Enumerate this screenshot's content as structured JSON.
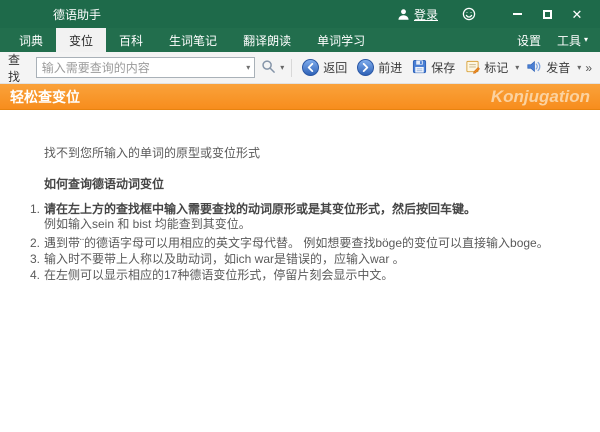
{
  "window": {
    "app_title": "德语助手",
    "login_label": "登录"
  },
  "menubar": {
    "tabs": [
      "词典",
      "变位",
      "百科",
      "生词笔记",
      "翻译朗读",
      "单词学习"
    ],
    "active_tab": "变位",
    "settings_label": "设置",
    "tools_label": "工具"
  },
  "toolbar": {
    "find_label": "查找",
    "search_placeholder": "输入需要查询的内容",
    "search_value": "",
    "back_label": "返回",
    "forward_label": "前进",
    "save_label": "保存",
    "mark_label": "标记",
    "speak_label": "发音",
    "overflow_label": "»"
  },
  "banner": {
    "title": "轻松查变位",
    "subtitle": "Konjugation"
  },
  "content": {
    "message": "找不到您所输入的单词的原型或变位形式",
    "howto_heading": "如何查询德语动词变位",
    "steps": [
      {
        "num": "1.",
        "line1": "请在左上方的查找框中输入需要查找的动词原形或是其变位形式，然后按回车键。",
        "line2": "例如输入sein 和 bist 均能查到其变位。"
      },
      {
        "num": "2.",
        "line1": "遇到带¨的德语字母可以用相应的英文字母代替。 例如想要查找böge的变位可以直接输入boge。"
      },
      {
        "num": "3.",
        "line1": "输入时不要带上人称以及助动词，如ich war是错误的，应输入war 。"
      },
      {
        "num": "4.",
        "line1": "在左侧可以显示相应的17种德语变位形式，停留片刻会显示中文。"
      }
    ]
  },
  "colors": {
    "theme_green_dark": "#1E6A4A",
    "theme_green_menu": "#226E4D",
    "banner_orange": "#F78D1D",
    "accent_blue": "#3C77C8"
  }
}
